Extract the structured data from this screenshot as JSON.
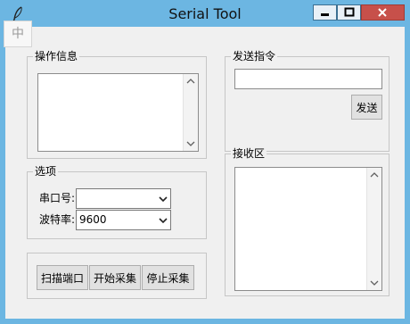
{
  "window": {
    "title": "Serial Tool"
  },
  "ime": {
    "indicator": "中"
  },
  "groups": {
    "operation_info": "操作信息",
    "send_command": "发送指令",
    "options": "选项",
    "receive_area": "接收区"
  },
  "send": {
    "input_value": "",
    "button_label": "发送"
  },
  "options": {
    "port_label": "串口号:",
    "port_value": "",
    "baud_label": "波特率:",
    "baud_value": "9600"
  },
  "actions": {
    "scan_label": "扫描端口",
    "start_label": "开始采集",
    "stop_label": "停止采集"
  },
  "colors": {
    "titlebar": "#6cb6e2",
    "close_button": "#c7504a",
    "client_bg": "#f0f0f0"
  }
}
